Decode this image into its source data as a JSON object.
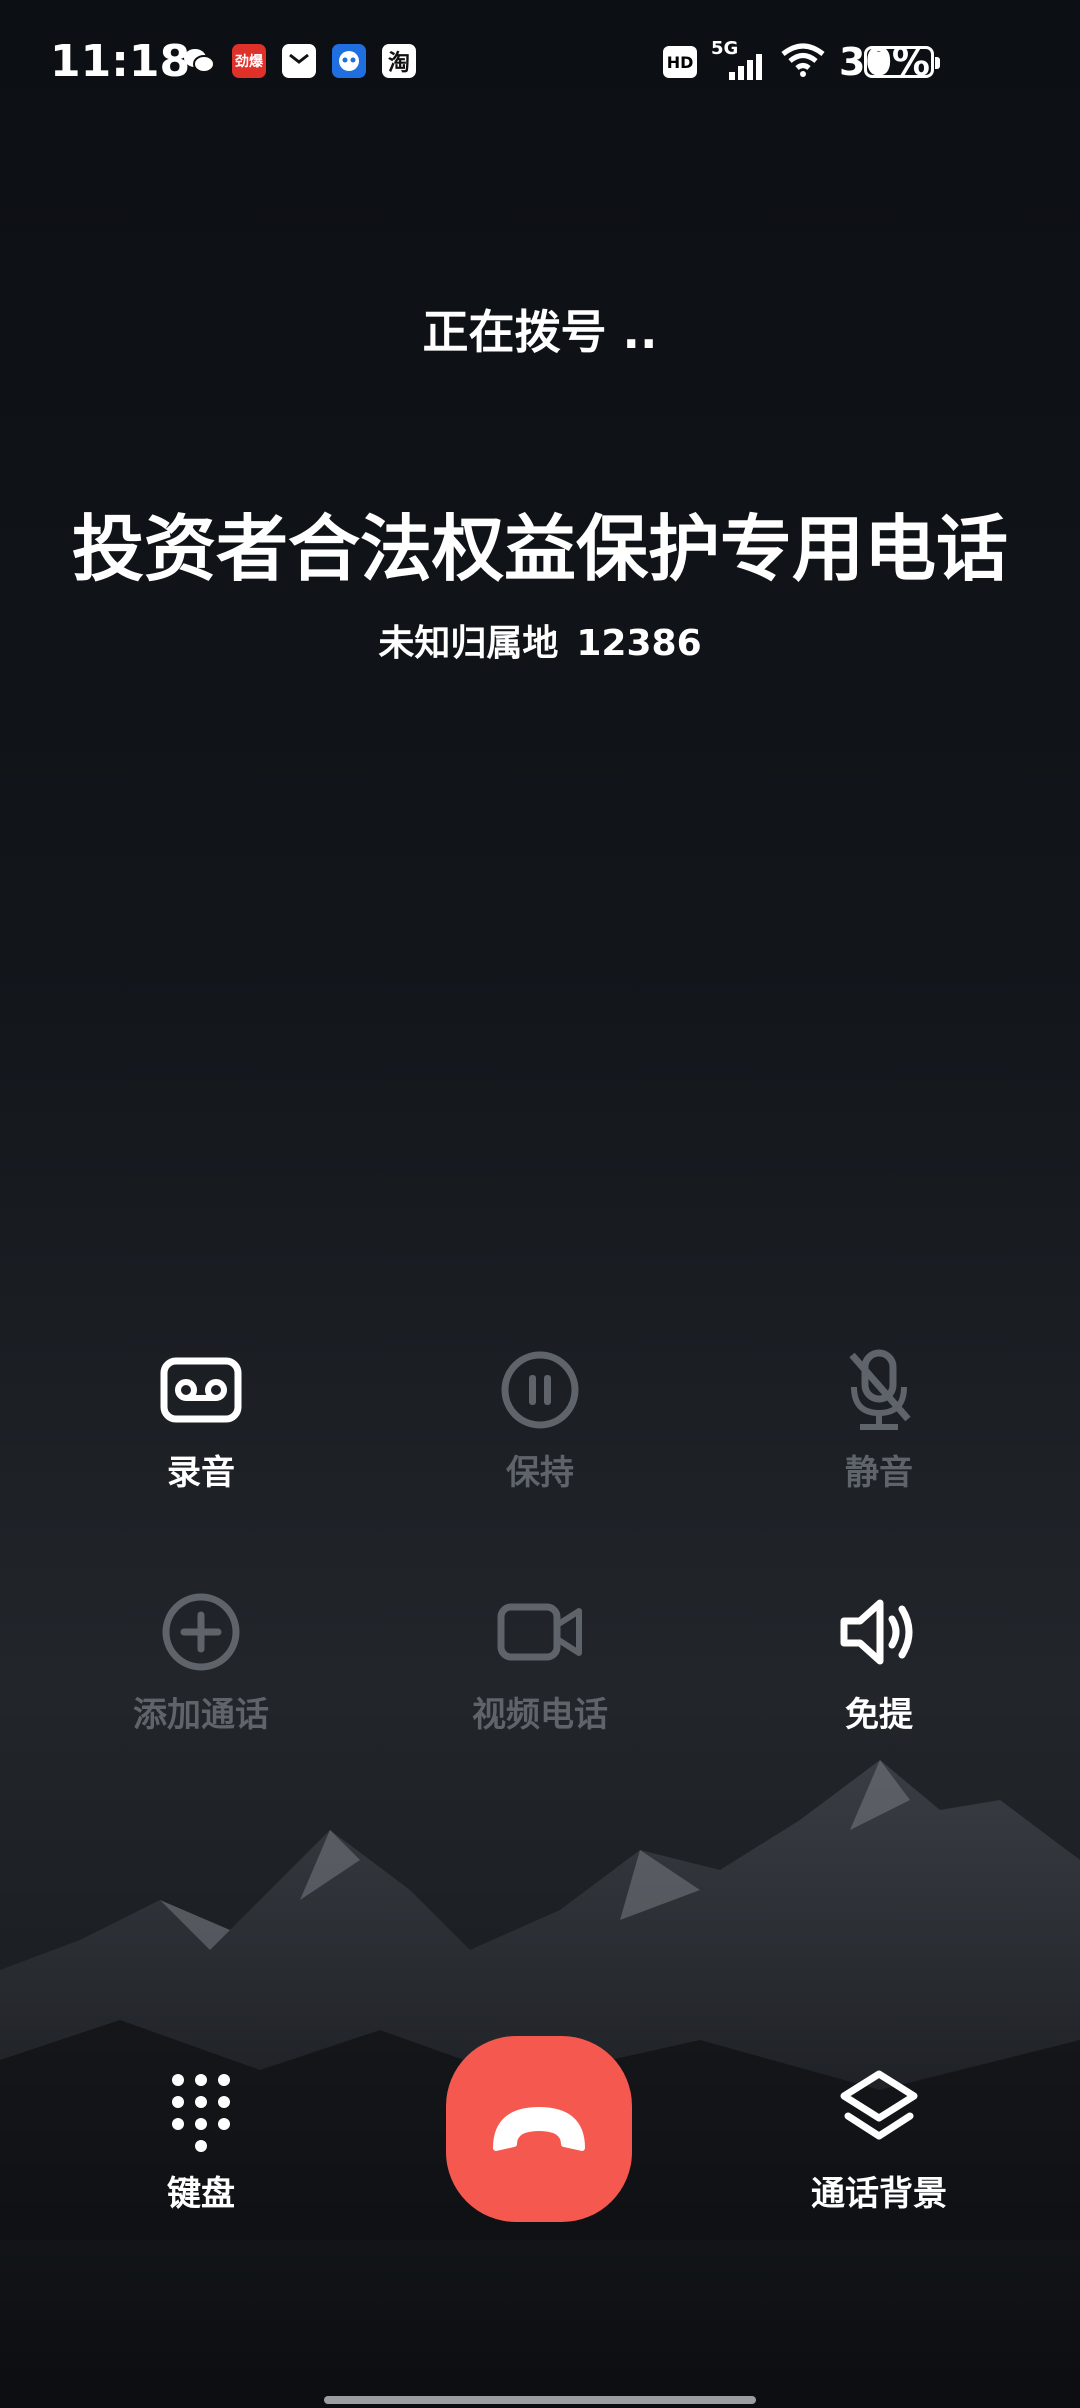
{
  "status_bar": {
    "time": "11:18",
    "apps": [
      {
        "name": "wechat-icon"
      },
      {
        "name": "news-app-icon",
        "text": "劲爆"
      },
      {
        "name": "mail-app-icon"
      },
      {
        "name": "assistant-app-icon"
      },
      {
        "name": "taobao-app-icon",
        "text": "淘"
      }
    ],
    "hd": "HD",
    "network": "5G",
    "battery_text": "30%",
    "battery_level": 0.3
  },
  "call": {
    "status": "正在拨号 ..",
    "name": "投资者合法权益保护专用电话",
    "location": "未知归属地",
    "number": "12386"
  },
  "controls": {
    "record": "录音",
    "hold": "保持",
    "mute": "静音",
    "add_call": "添加通话",
    "video_call": "视频电话",
    "speaker": "免提",
    "keypad": "键盘",
    "background": "通话背景"
  },
  "colors": {
    "end_call": "#f4584e",
    "disabled": "#5f636a"
  }
}
